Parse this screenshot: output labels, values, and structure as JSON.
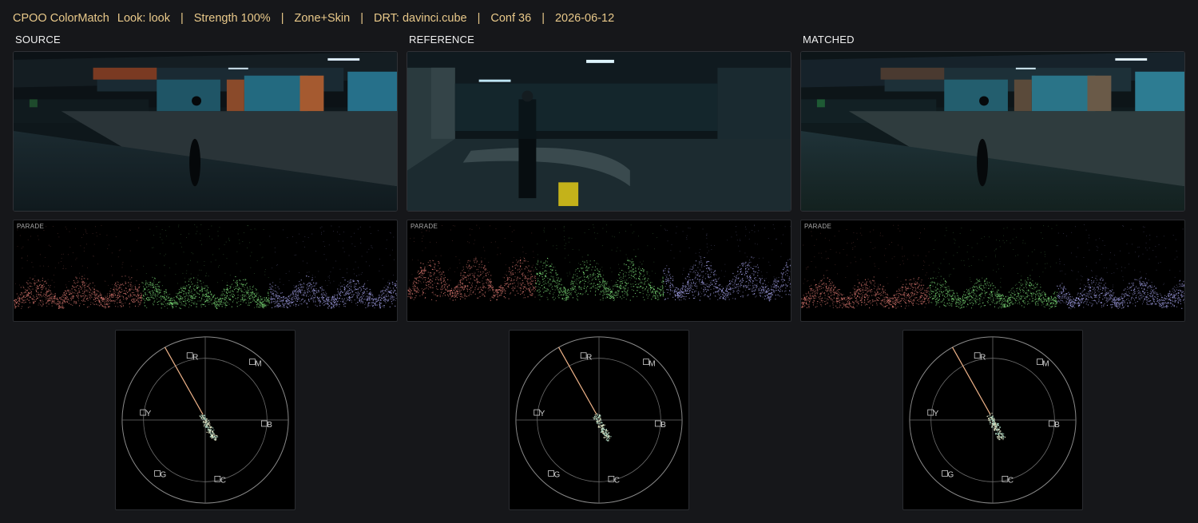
{
  "status": {
    "app": "CPOO ColorMatch",
    "look": "Look: look",
    "strength": "Strength 100%",
    "mode": "Zone+Skin",
    "drt": "DRT: davinci.cube",
    "conf": "Conf 36",
    "date": "2026-06-12",
    "separator": "|"
  },
  "panels": [
    {
      "label": "SOURCE",
      "parade_label": "PARADE"
    },
    {
      "label": "REFERENCE",
      "parade_label": "PARADE"
    },
    {
      "label": "MATCHED",
      "parade_label": "PARADE"
    }
  ],
  "vectorscope_targets": {
    "r": "R",
    "m": "M",
    "y": "Y",
    "b": "B",
    "g": "G",
    "c": "C"
  },
  "colors": {
    "accent": "#e9c98a",
    "parade_red": "#e07b73",
    "parade_green": "#7ee07a",
    "parade_blue": "#a8a6f0",
    "skin_line": "#f0b48a"
  }
}
